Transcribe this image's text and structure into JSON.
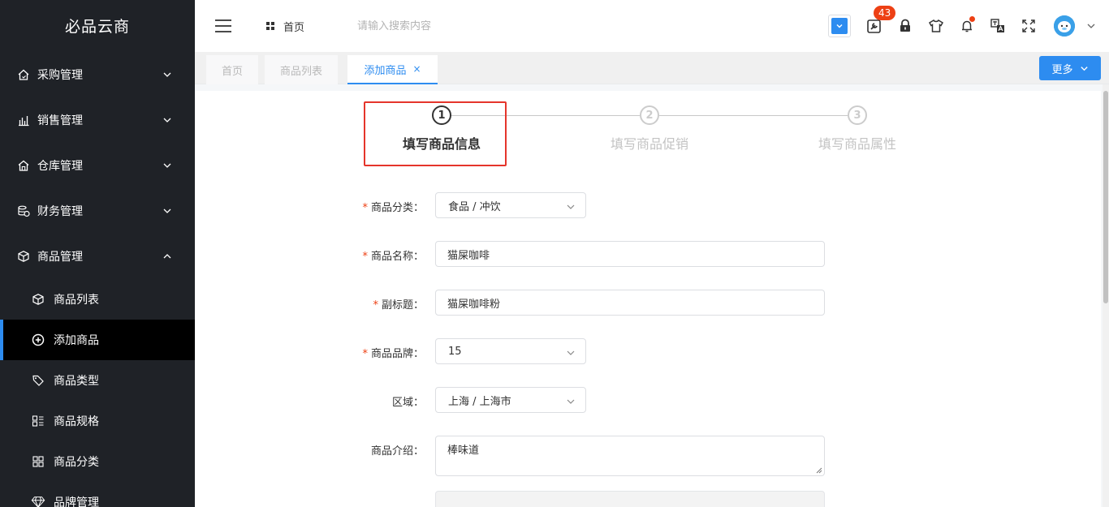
{
  "sidebar": {
    "logo": "必品云商",
    "groups": [
      {
        "label": "采购管理",
        "icon": "home-icon",
        "expanded": false
      },
      {
        "label": "销售管理",
        "icon": "bar-chart-icon",
        "expanded": false
      },
      {
        "label": "仓库管理",
        "icon": "warehouse-icon",
        "expanded": false
      },
      {
        "label": "财务管理",
        "icon": "finance-icon",
        "expanded": false
      },
      {
        "label": "商品管理",
        "icon": "cube-icon",
        "expanded": true
      }
    ],
    "sub_items": [
      {
        "label": "商品列表",
        "icon": "cube-icon"
      },
      {
        "label": "添加商品",
        "icon": "plus-circle-icon",
        "active": true
      },
      {
        "label": "商品类型",
        "icon": "tag-icon"
      },
      {
        "label": "商品规格",
        "icon": "spec-list-icon"
      },
      {
        "label": "商品分类",
        "icon": "grid-icon"
      },
      {
        "label": "品牌管理",
        "icon": "diamond-icon"
      }
    ]
  },
  "header": {
    "breadcrumb": "首页",
    "search_placeholder": "请输入搜索内容",
    "badge_count": "43",
    "icons": [
      "dropdown-select-icon",
      "tools-icon",
      "lock-icon",
      "shirt-icon",
      "bell-icon",
      "translate-icon",
      "fullscreen-icon",
      "avatar"
    ]
  },
  "tabs": {
    "items": [
      {
        "label": "首页"
      },
      {
        "label": "商品列表"
      },
      {
        "label": "添加商品",
        "active": true,
        "close": "×"
      }
    ],
    "more_label": "更多"
  },
  "steps": [
    {
      "number": "1",
      "title": "填写商品信息",
      "current": true
    },
    {
      "number": "2",
      "title": "填写商品促销",
      "current": false
    },
    {
      "number": "3",
      "title": "填写商品属性",
      "current": false
    }
  ],
  "form": {
    "category": {
      "label": "商品分类：",
      "value": "食品 / 冲饮",
      "required": true
    },
    "name": {
      "label": "商品名称：",
      "value": "猫屎咖啡",
      "required": true
    },
    "subtitle": {
      "label": "副标题：",
      "value": "猫屎咖啡粉",
      "required": true
    },
    "brand": {
      "label": "商品品牌：",
      "value": "15",
      "required": true
    },
    "region": {
      "label": "区域：",
      "value": "上海 / 上海市",
      "required": false
    },
    "description": {
      "label": "商品介绍：",
      "value": "棒味道",
      "required": false
    }
  },
  "colors": {
    "sidebar_bg": "#1f2227",
    "accent": "#2d8cf0",
    "required": "#ed4014",
    "highlight": "#e5352b"
  }
}
